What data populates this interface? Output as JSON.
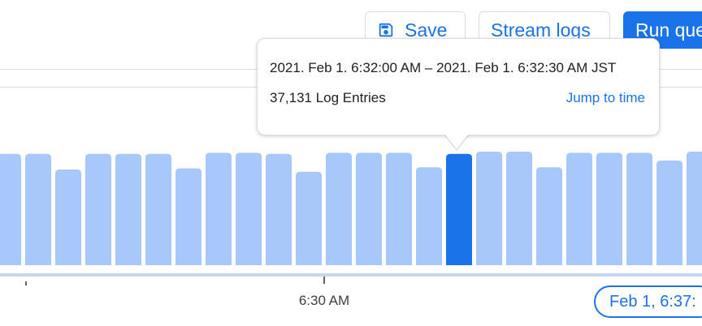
{
  "toolbar": {
    "save_label": "Save",
    "stream_logs_label": "Stream logs",
    "run_query_label": "Run que"
  },
  "tooltip": {
    "time_range": "2021. Feb 1. 6:32:00 AM – 2021. Feb 1. 6:32:30 AM JST",
    "log_entries": "37,131 Log Entries",
    "jump_label": "Jump to time"
  },
  "timeline": {
    "tick_label": "6:30 AM",
    "current_chip": "Feb 1, 6:37:"
  },
  "colors": {
    "accent": "#1a73e8",
    "bar": "#a8c7fa",
    "bar_selected": "#1a73e8"
  },
  "chart_data": {
    "type": "bar",
    "values": [
      100,
      100,
      86,
      100,
      100,
      100,
      87,
      101,
      101,
      100,
      84,
      101,
      101,
      101,
      88,
      100,
      102,
      102,
      88,
      101,
      101,
      101,
      94,
      102
    ],
    "selected_index": 15
  }
}
